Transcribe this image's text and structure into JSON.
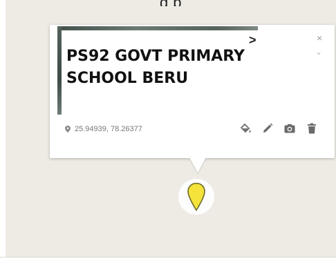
{
  "header": {
    "caption_fragment": "g   p"
  },
  "info_window": {
    "title": "PS92 GOVT PRIMARY SCHOOL BERU",
    "coordinates": "25.94939, 78.26377",
    "nav_next_label": ">",
    "close_label": "×",
    "scroll_label": "⌄",
    "actions": [
      {
        "name": "style-paint-icon",
        "label": "Style"
      },
      {
        "name": "edit-pencil-icon",
        "label": "Edit"
      },
      {
        "name": "add-photo-icon",
        "label": "Add image"
      },
      {
        "name": "delete-trash-icon",
        "label": "Delete"
      }
    ]
  },
  "marker": {
    "color": "#f5e23a",
    "outline": "#6b6a2a"
  },
  "colors": {
    "map_background": "#eeebe4",
    "card_background": "#ffffff",
    "icon_gray": "#6f6f6f"
  }
}
